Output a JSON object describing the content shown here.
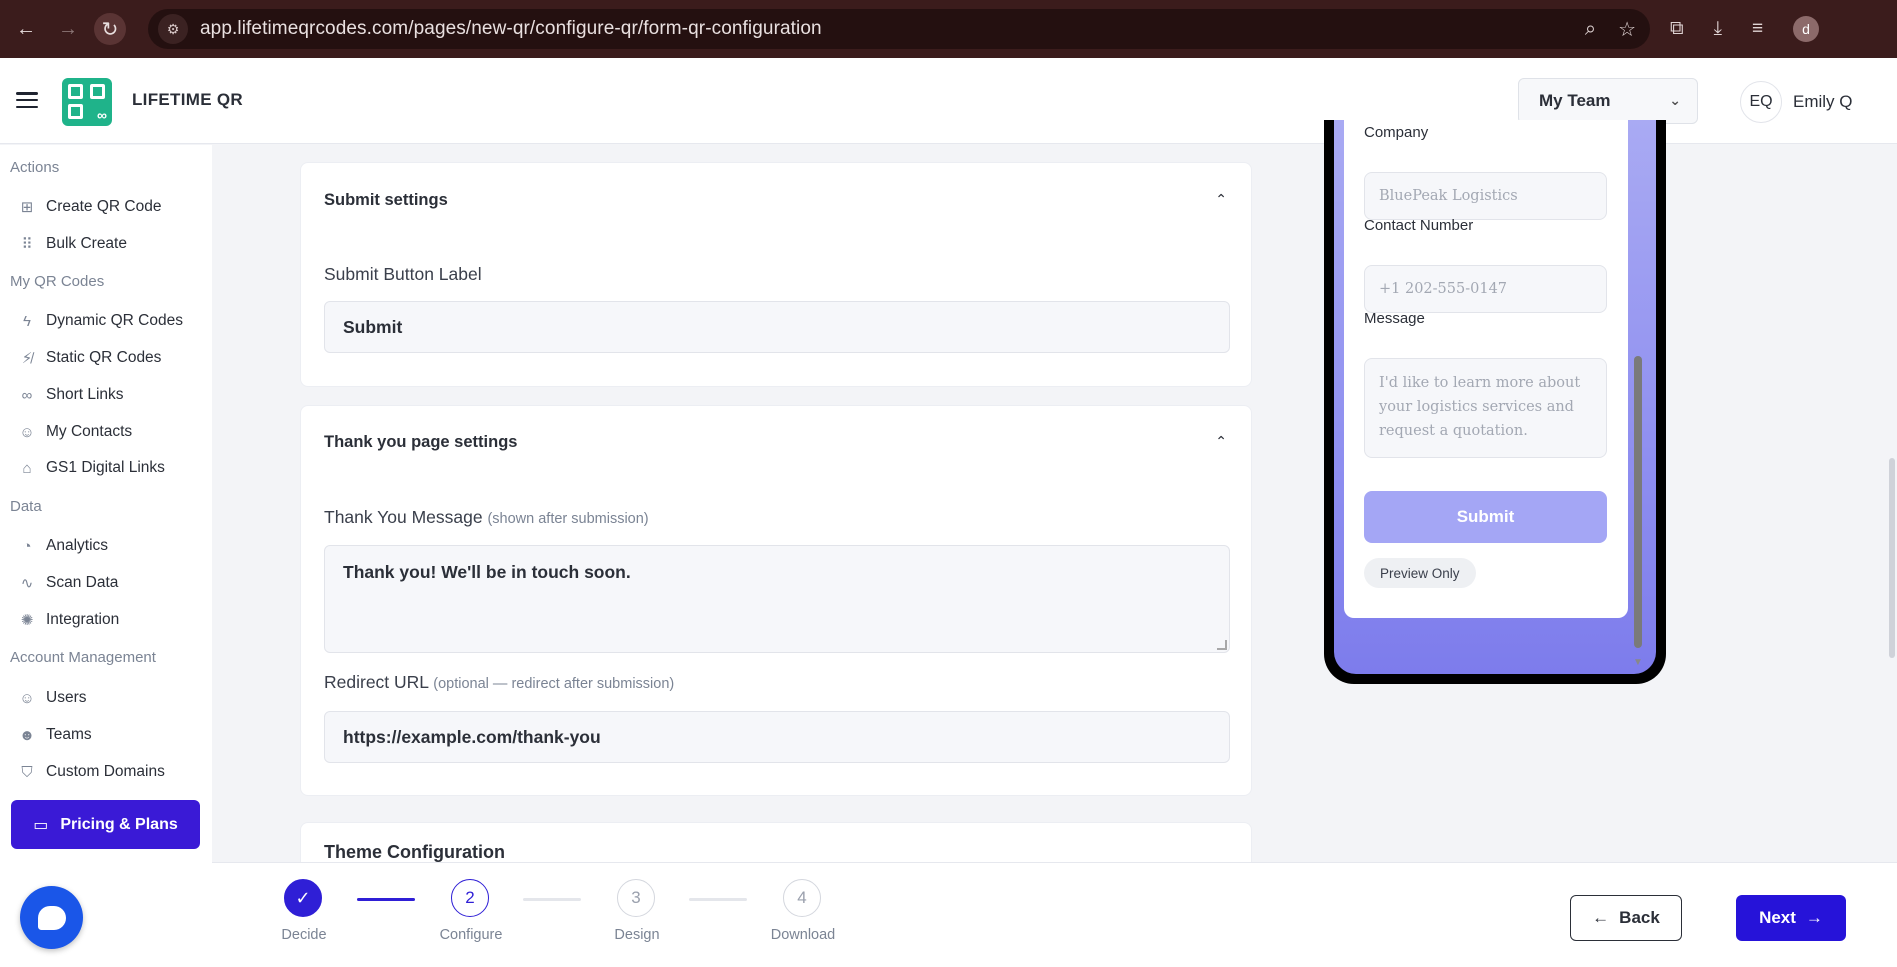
{
  "browser": {
    "url": "app.lifetimeqrcodes.com/pages/new-qr/configure-qr/form-qr-configuration",
    "profile_initial": "d"
  },
  "header": {
    "brand": "LIFETIME QR",
    "team_select": "My Team",
    "avatar_initials": "EQ",
    "user_name": "Emily Q"
  },
  "sidebar": {
    "sections": [
      {
        "title": "Actions",
        "items": [
          "Create QR Code",
          "Bulk Create"
        ]
      },
      {
        "title": "My QR Codes",
        "items": [
          "Dynamic QR Codes",
          "Static QR Codes",
          "Short Links",
          "My Contacts",
          "GS1 Digital Links"
        ]
      },
      {
        "title": "Data",
        "items": [
          "Analytics",
          "Scan Data",
          "Integration"
        ]
      },
      {
        "title": "Account Management",
        "items": [
          "Users",
          "Teams",
          "Custom Domains"
        ]
      }
    ],
    "pricing_button": "Pricing & Plans"
  },
  "submit_settings": {
    "title": "Submit settings",
    "button_label_field": "Submit Button Label",
    "button_label_value": "Submit"
  },
  "thankyou_settings": {
    "title": "Thank you page settings",
    "message_label": "Thank You Message",
    "message_hint": "(shown after submission)",
    "message_value": "Thank you! We'll be in touch soon.",
    "redirect_label": "Redirect URL",
    "redirect_hint": "(optional — redirect after submission)",
    "redirect_value": "https://example.com/thank-you"
  },
  "theme_config": {
    "title": "Theme Configuration"
  },
  "preview": {
    "company_label": "Company",
    "company_placeholder": "BluePeak Logistics",
    "contact_label": "Contact Number",
    "contact_placeholder": "+1 202-555-0147",
    "message_label": "Message",
    "message_placeholder": "I'd like to learn more about your logistics services and request a quotation.",
    "submit_label": "Submit",
    "preview_only": "Preview Only"
  },
  "stepper": {
    "steps": [
      {
        "number": "✓",
        "label": "Decide",
        "state": "done"
      },
      {
        "number": "2",
        "label": "Configure",
        "state": "active"
      },
      {
        "number": "3",
        "label": "Design",
        "state": "pending"
      },
      {
        "number": "4",
        "label": "Download",
        "state": "pending"
      }
    ],
    "back_label": "Back",
    "next_label": "Next"
  },
  "colors": {
    "accent": "#2f1fd6",
    "logo": "#1fb38a",
    "chrome": "#3b1c1c"
  }
}
